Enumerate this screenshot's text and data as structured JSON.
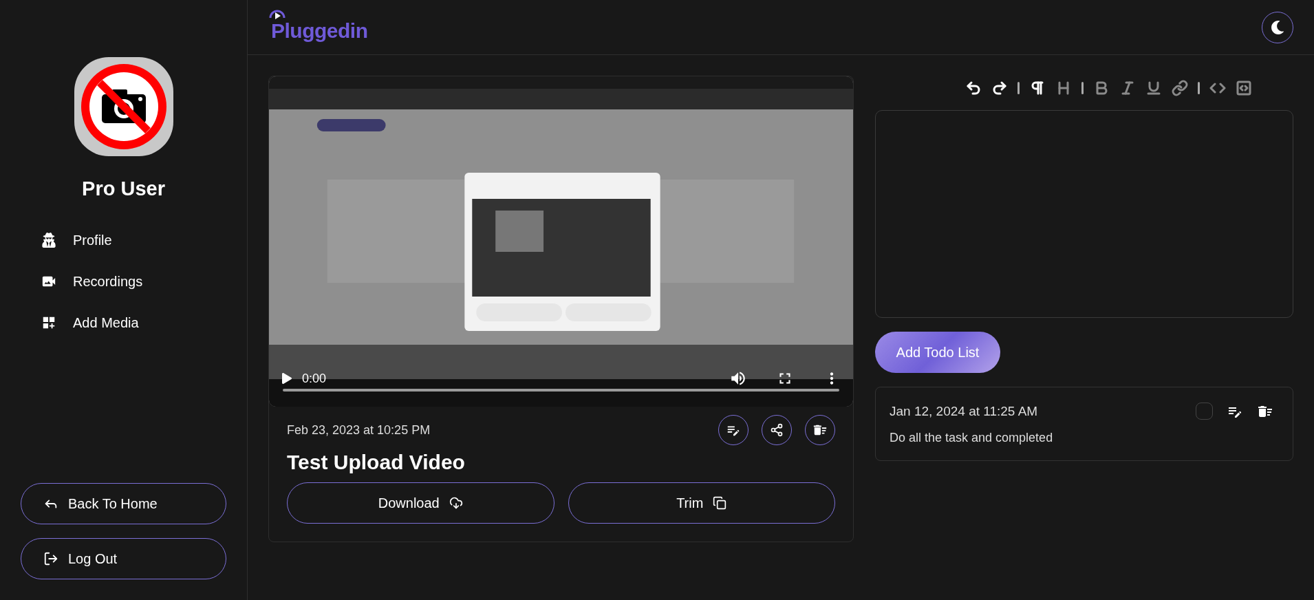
{
  "sidebar": {
    "user_name": "Pro User",
    "nav": [
      {
        "kind": "profile",
        "label": "Profile"
      },
      {
        "kind": "recordings",
        "label": "Recordings"
      },
      {
        "kind": "add-media",
        "label": "Add Media"
      }
    ],
    "actions": [
      {
        "kind": "back",
        "label": "Back To Home"
      },
      {
        "kind": "logout",
        "label": "Log Out"
      }
    ]
  },
  "header": {
    "logo": "Pluggedin"
  },
  "video": {
    "player": {
      "time": "0:00"
    },
    "date": "Feb 23, 2023 at 10:25 PM",
    "title": "Test Upload Video",
    "buttons": [
      {
        "kind": "download",
        "label": "Download"
      },
      {
        "kind": "trim",
        "label": "Trim"
      }
    ]
  },
  "editor": {
    "toolbar": [
      {
        "kind": "undo",
        "disabled": false
      },
      {
        "kind": "redo",
        "disabled": false
      },
      {
        "kind": "separator"
      },
      {
        "kind": "paragraph",
        "disabled": false
      },
      {
        "kind": "heading",
        "disabled": true
      },
      {
        "kind": "separator"
      },
      {
        "kind": "bold",
        "disabled": true
      },
      {
        "kind": "italic",
        "disabled": true
      },
      {
        "kind": "underline",
        "disabled": true
      },
      {
        "kind": "link",
        "disabled": true
      },
      {
        "kind": "separator"
      },
      {
        "kind": "code",
        "disabled": true
      },
      {
        "kind": "code-block",
        "disabled": true
      }
    ],
    "add_button": "Add Todo List"
  },
  "todos": [
    {
      "date": "Jan 12, 2024 at 11:25 AM",
      "text": "Do all the task and completed",
      "checked": false
    }
  ]
}
